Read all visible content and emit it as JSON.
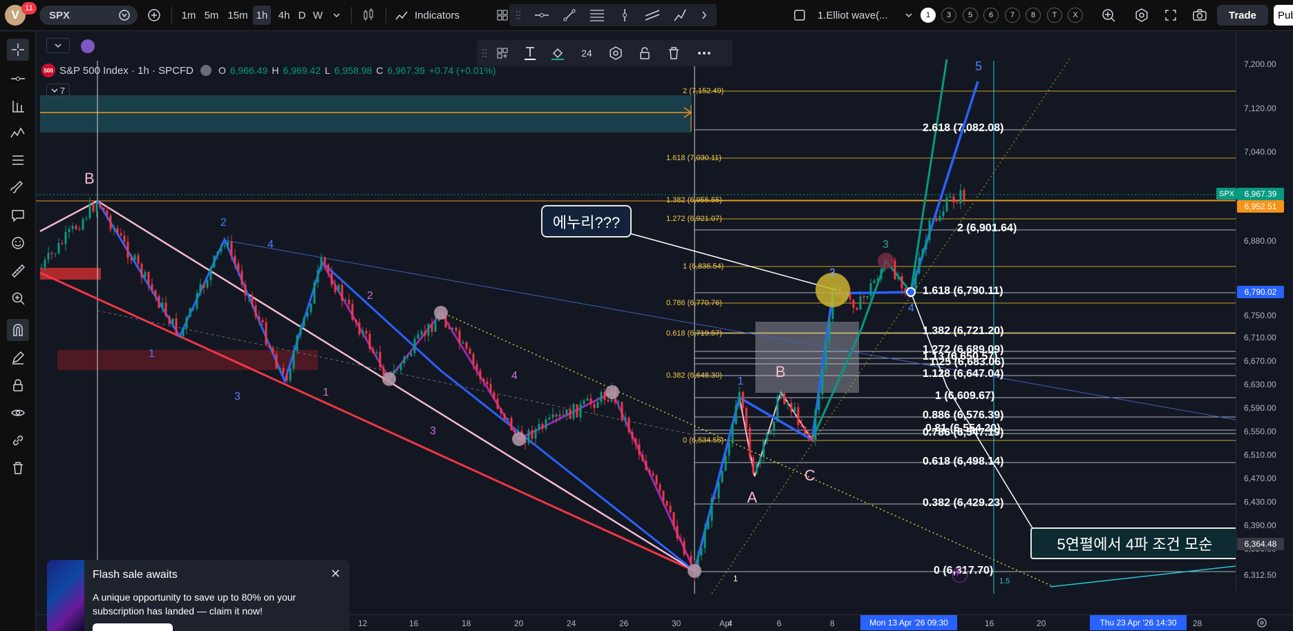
{
  "topbar": {
    "avatar_initial": "V",
    "notifications": "11",
    "symbol": "SPX",
    "intervals": [
      "1m",
      "5m",
      "15m",
      "1h",
      "4h",
      "D",
      "W"
    ],
    "active_interval": "1h",
    "indicators_label": "Indicators",
    "layout_name": "1.Elliot wave(...",
    "visibility_buttons": [
      "1",
      "3",
      "5",
      "6",
      "7",
      "8",
      "T",
      "X"
    ],
    "trade_label": "Trade",
    "publish_label": "Pub"
  },
  "text_toolbar": {
    "font_size": "24"
  },
  "legend": {
    "badge": "500",
    "title": "S&P 500 Index · 1h · SPCFD",
    "o_label": "O",
    "o": "6,966.49",
    "h_label": "H",
    "h": "6,969.42",
    "l_label": "L",
    "l": "6,958.98",
    "c_label": "C",
    "c": "6,967.39",
    "change": "+0.74 (+0.01%)",
    "indicator_count": "7"
  },
  "price_axis": {
    "labels": [
      "7,200.00",
      "7,120.00",
      "7,040.00",
      "6,880.00",
      "6,750.00",
      "6,710.00",
      "6,670.00",
      "6,630.00",
      "6,590.00",
      "6,550.00",
      "6,510.00",
      "6,470.00",
      "6,430.00",
      "6,390.00",
      "6,350.00",
      "6,312.50"
    ],
    "symbol_tag": "SPX",
    "last_price": "6,967.39",
    "orange_price": "6,952.51",
    "blue_price": "6,790.02",
    "low_price": "6,364.48"
  },
  "time_axis": {
    "labels": [
      "12",
      "16",
      "18",
      "20",
      "24",
      "26",
      "30",
      "Apr",
      "4",
      "6",
      "8",
      "16",
      "20",
      "28"
    ],
    "tag1": "Mon 13 Apr '26   09:30",
    "tag2": "Thu 23 Apr '26   14:30"
  },
  "fib_small": [
    "2 (7,152.49)",
    "1.618 (7,030.11)",
    "1.382 (6,955.55)",
    "1.272 (6,921.07)",
    "1 (6,836.54)",
    "0.786 (6,770.76)",
    "0.618 (6,719.57)",
    "0.382 (6,648.30)",
    "0 (6,534.55)"
  ],
  "fib_large": [
    "2.618 (7,082.08)",
    "2 (6,901.64)",
    "1.618 (6,790.11)",
    "1.382 (6,721.20)",
    "1.272 (6,689.09)",
    "1.13 (6,650.57)",
    "1.25 (6,683.06)",
    "1.128 (6,647.04)",
    "1 (6,609.67)",
    "0.886 (6,576.39)",
    "0.81 (6,554.20)",
    "0.786 (6,547.19)",
    "0.618 (6,498.14)",
    "0.382 (6,429.23)",
    "0 (6,317.70)"
  ],
  "wave_labels": {
    "B_left": "B",
    "w1": "1",
    "w2": "2",
    "w3": "3",
    "w4": "4",
    "p1": "1",
    "p2": "2",
    "p3": "3",
    "p4": "4",
    "A": "A",
    "B": "B",
    "C": "C",
    "n1": "1",
    "n3": "3",
    "n4": "4",
    "n5": "5",
    "g3": "3",
    "bottom1": "1",
    "small15": "1.5"
  },
  "annotations": {
    "callout_1": "에누리???",
    "callout_2": "5연펼에서 4파 조건 모순"
  },
  "flash_sale": {
    "title": "Flash sale awaits",
    "text": "A unique opportunity to save up to 80% on your subscription has landed — claim it now!"
  },
  "colors": {
    "background": "#131722",
    "up": "#089981",
    "down": "#f23645",
    "blue_wave": "#2962ff",
    "purple_wave": "#9c27b0",
    "pink_wave": "#f8bbd0",
    "green_wave": "#089981",
    "fib_yellow": "#f7c948"
  }
}
